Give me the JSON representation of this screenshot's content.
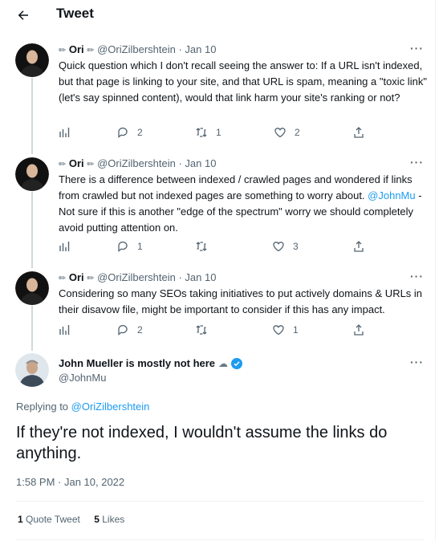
{
  "header": {
    "title": "Tweet",
    "back_icon": "arrow-left-icon"
  },
  "thread": [
    {
      "badge": "✏",
      "name": "Ori",
      "handle_badge": "✏",
      "handle": "@OriZilbershtein",
      "date": "Jan 10",
      "text": "Quick question which I don't recall seeing the answer to: If a URL isn't indexed, but that page is linking to your site, and that URL is spam, meaning a \"toxic link\" (let's say spinned content), would that link harm your site's ranking or not?",
      "replies": "2",
      "retweets": "1",
      "likes": "2"
    },
    {
      "badge": "✏",
      "name": "Ori",
      "handle_badge": "✏",
      "handle": "@OriZilbershtein",
      "date": "Jan 10",
      "text_before": "There is a difference between indexed / crawled pages and wondered if links from crawled but not indexed pages are something to worry about.",
      "mention": "@JohnMu",
      "text_after": " - Not sure if this is another \"edge of the spectrum\" worry we should completely avoid putting attention on.",
      "replies": "1",
      "retweets": "",
      "likes": "3"
    },
    {
      "badge": "✏",
      "name": "Ori",
      "handle_badge": "✏",
      "handle": "@OriZilbershtein",
      "date": "Jan 10",
      "text": "Considering so many SEOs taking initiatives to put actively domains & URLs in their disavow file, might be important to consider if this has any impact.",
      "replies": "2",
      "retweets": "",
      "likes": "1"
    }
  ],
  "main_tweet": {
    "name": "John Mueller is mostly not here",
    "name_emoji": "☁",
    "handle": "@JohnMu",
    "replying_prefix": "Replying to ",
    "replying_handle": "@OriZilbershtein",
    "text": "If they're not indexed, I wouldn't assume the links do anything.",
    "timestamp": "1:58 PM · Jan 10, 2022",
    "quote_count": "1",
    "quote_label": "Quote Tweet",
    "like_count": "5",
    "like_label": "Likes"
  },
  "more_glyph": "···",
  "colors": {
    "accent": "#1d9bf0",
    "muted": "#536471",
    "text": "#0f1419",
    "line": "#cfd9de"
  }
}
